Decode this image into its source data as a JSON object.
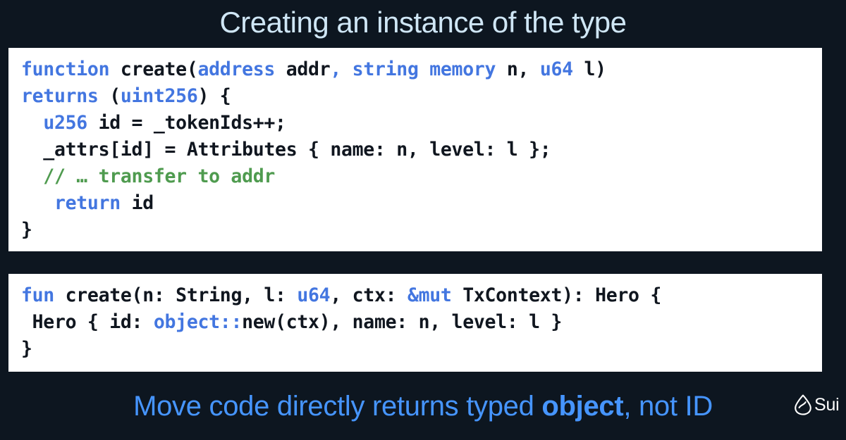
{
  "slide": {
    "background_color": "#0d1620",
    "title": "Creating an instance of the type",
    "title_color": "#cfe6f5"
  },
  "colors": {
    "keyword_blue": "#4376e0",
    "comment_green": "#4f9b4f",
    "code_text": "#10161f",
    "caption_blue": "#4695ff",
    "card_background": "#ffffff"
  },
  "code_blocks": [
    {
      "id": "solidity",
      "language": "solidity",
      "lines": [
        [
          {
            "t": "function ",
            "c": "kw"
          },
          {
            "t": "create(",
            "c": "pln"
          },
          {
            "t": "address ",
            "c": "kw"
          },
          {
            "t": "addr",
            "c": "pln"
          },
          {
            "t": ", ",
            "c": "kw"
          },
          {
            "t": "string memory ",
            "c": "kw"
          },
          {
            "t": "n, ",
            "c": "pln"
          },
          {
            "t": "u64 ",
            "c": "kw"
          },
          {
            "t": "l)",
            "c": "pln"
          }
        ],
        [
          {
            "t": "returns ",
            "c": "kw"
          },
          {
            "t": "(",
            "c": "pln"
          },
          {
            "t": "uint256",
            "c": "kw"
          },
          {
            "t": ") {",
            "c": "pln"
          }
        ],
        [
          {
            "t": "  ",
            "c": "pln"
          },
          {
            "t": "u256",
            "c": "kw"
          },
          {
            "t": " id = _tokenIds++;",
            "c": "pln"
          }
        ],
        [
          {
            "t": "  _attrs[id] = Attributes { name: n, level: l };",
            "c": "pln"
          }
        ],
        [
          {
            "t": "  // … transfer to addr",
            "c": "com"
          }
        ],
        [
          {
            "t": "   ",
            "c": "pln"
          },
          {
            "t": "return ",
            "c": "kw"
          },
          {
            "t": "id",
            "c": "pln"
          }
        ],
        [
          {
            "t": "}",
            "c": "pln"
          }
        ]
      ]
    },
    {
      "id": "move",
      "language": "move",
      "lines": [
        [
          {
            "t": "fun ",
            "c": "kw"
          },
          {
            "t": "create(n: String, l: ",
            "c": "pln"
          },
          {
            "t": "u64",
            "c": "kw"
          },
          {
            "t": ", ctx: ",
            "c": "pln"
          },
          {
            "t": "&mut ",
            "c": "kw"
          },
          {
            "t": "TxContext): Hero {",
            "c": "pln"
          }
        ],
        [
          {
            "t": " Hero { id: ",
            "c": "pln"
          },
          {
            "t": "object::",
            "c": "kw"
          },
          {
            "t": "new(ctx), name: n, level: l }",
            "c": "pln"
          }
        ],
        [
          {
            "t": "}",
            "c": "pln"
          }
        ]
      ]
    }
  ],
  "caption": {
    "part1": "Move code directly returns typed ",
    "emphasis": "object",
    "part2": ", not ID"
  },
  "logo": {
    "icon": "sui-droplet-icon",
    "word": "Sui"
  }
}
